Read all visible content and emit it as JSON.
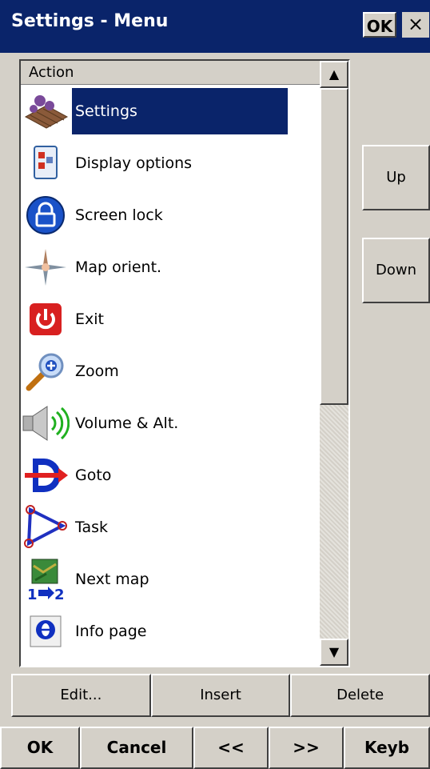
{
  "window": {
    "title": "Settings - Menu",
    "ok_label": "OK",
    "close_glyph": "×"
  },
  "list": {
    "header": "Action",
    "items": [
      {
        "label": "Settings",
        "icon": "settings-icon",
        "selected": true
      },
      {
        "label": "Display options",
        "icon": "display-options-icon"
      },
      {
        "label": "Screen lock",
        "icon": "lock-icon"
      },
      {
        "label": "Map orient.",
        "icon": "compass-icon"
      },
      {
        "label": "Exit",
        "icon": "power-icon"
      },
      {
        "label": "Zoom",
        "icon": "magnifier-icon"
      },
      {
        "label": "Volume & Alt.",
        "icon": "speaker-icon"
      },
      {
        "label": "Goto",
        "icon": "goto-icon"
      },
      {
        "label": "Task",
        "icon": "task-icon"
      },
      {
        "label": "Next map",
        "icon": "next-map-icon"
      },
      {
        "label": "Info page",
        "icon": "info-icon"
      }
    ],
    "scroll_up_glyph": "▲",
    "scroll_down_glyph": "▼"
  },
  "side_buttons": {
    "up": "Up",
    "down": "Down"
  },
  "edit_bar": {
    "edit": "Edit...",
    "insert": "Insert",
    "delete": "Delete"
  },
  "bottom_bar": {
    "ok": "OK",
    "cancel": "Cancel",
    "prev": "<<",
    "next": ">>",
    "keyb": "Keyb"
  },
  "colors": {
    "titlebar": "#0a246a",
    "selection": "#0a246a",
    "face": "#d4d0c8"
  }
}
